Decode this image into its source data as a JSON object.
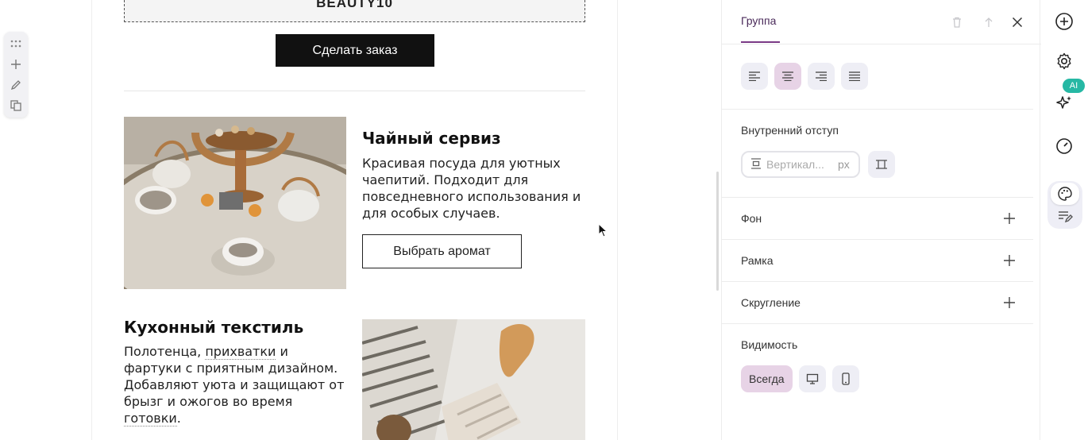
{
  "canvas": {
    "promo_code": "BEAUTY10",
    "order_button": "Сделать заказ",
    "products": [
      {
        "title": "Чайный сервиз",
        "desc": "Красивая посуда для уютных чаепитий. Подходит для повседневного использования и для особых случаев.",
        "button": "Выбрать аромат"
      },
      {
        "title": "Кухонный текстиль",
        "desc_parts": [
          "Полотенца, ",
          "прихватки",
          " и фартуки с приятным дизайном. Добавляют уюта и защищают от брызг и ожогов во время ",
          "готовки",
          "."
        ]
      }
    ]
  },
  "panel": {
    "tab_label": "Группа",
    "padding_label": "Внутренний отступ",
    "padding_placeholder": "Вертикал...",
    "padding_unit": "px",
    "sections": [
      "Фон",
      "Рамка",
      "Скругление"
    ],
    "visibility_label": "Видимость",
    "visibility_always": "Всегда"
  },
  "rail": {
    "ai_badge": "AI"
  },
  "colors": {
    "accent": "#7a3a86",
    "active_bg": "#e7d3e6",
    "ai_badge": "#26b8a4"
  }
}
